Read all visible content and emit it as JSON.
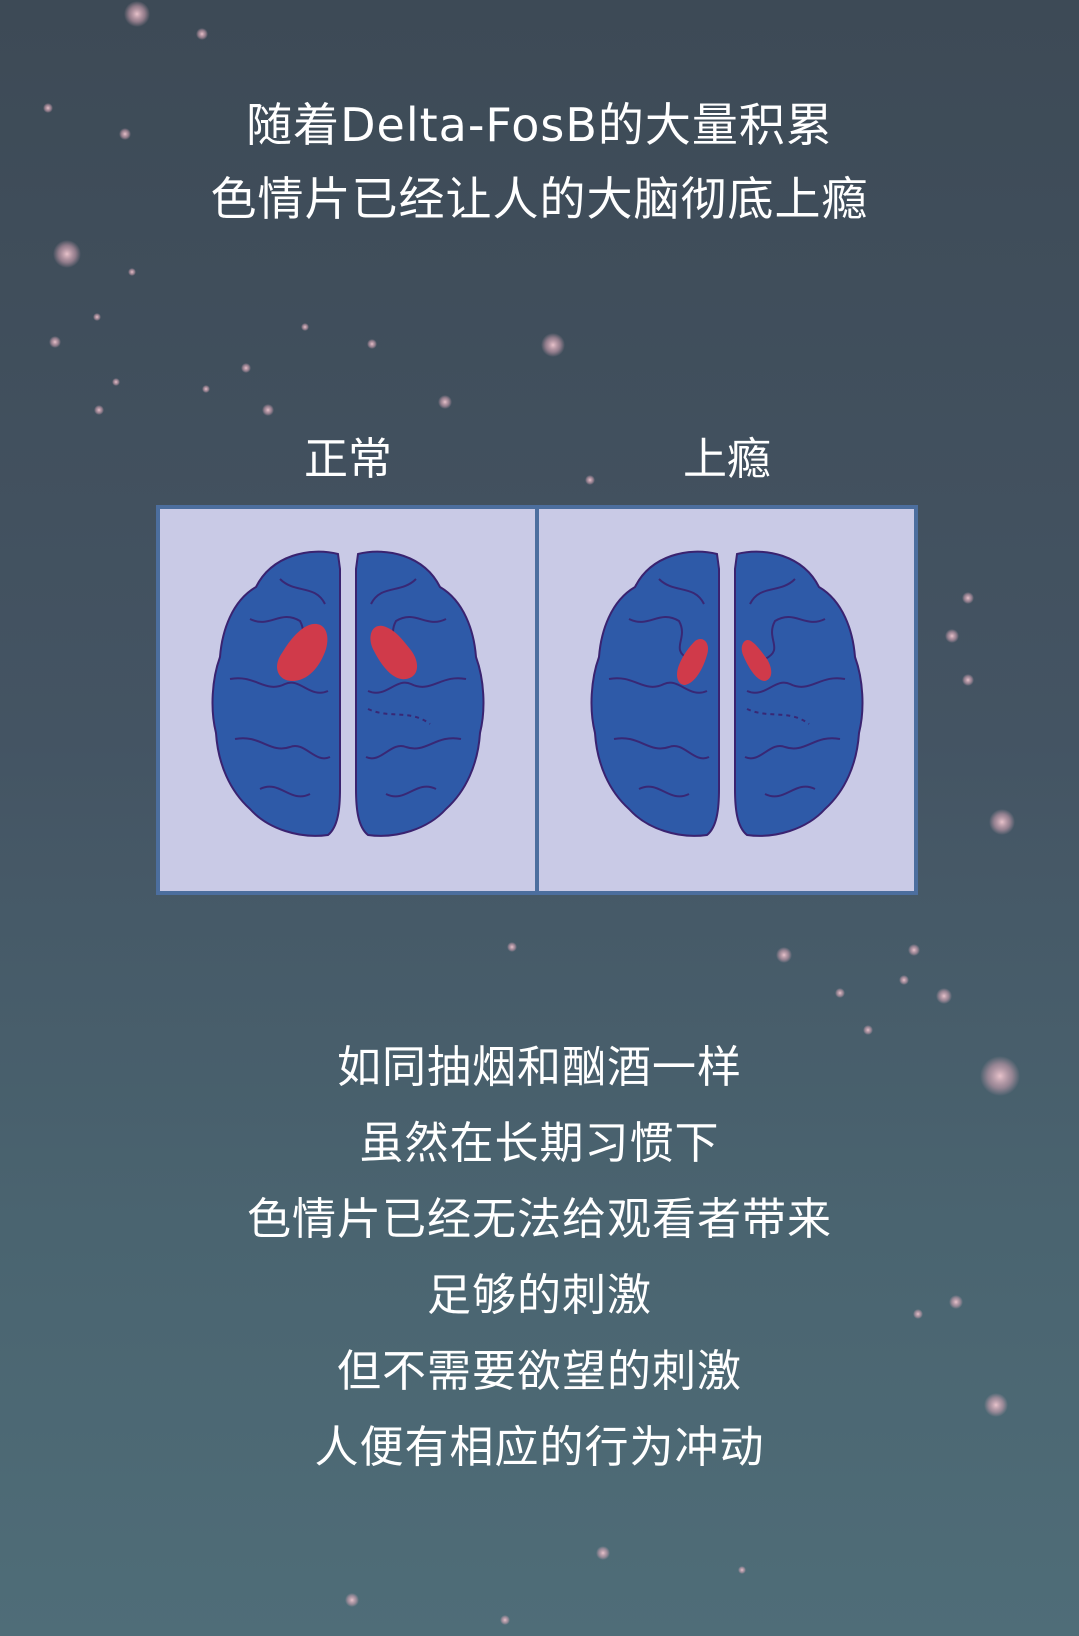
{
  "heading": {
    "line1": "随着Delta-FosB的大量积累",
    "line2": "色情片已经让人的大脑彻底上瘾"
  },
  "figure": {
    "left_label": "正常",
    "right_label": "上瘾",
    "colors": {
      "brain": "#2e5aa8",
      "outline": "#3a2370",
      "highlight": "#d03a4a",
      "panel": "#c9cae6",
      "border": "#4c6e9e"
    }
  },
  "body": {
    "lines": [
      "如同抽烟和酗酒一样",
      "虽然在长期习惯下",
      "色情片已经无法给观看者带来",
      "足够的刺激",
      "但不需要欲望的刺激",
      "人便有相应的行为冲动"
    ]
  }
}
